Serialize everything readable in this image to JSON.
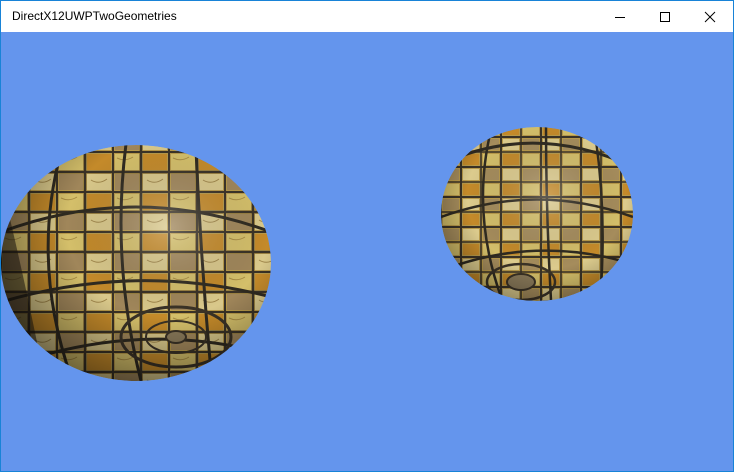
{
  "window": {
    "title": "DirectX12UWPTwoGeometries",
    "clear_color": "#6495ED"
  },
  "caption_buttons": {
    "minimize": "minimize-icon",
    "maximize": "maximize-icon",
    "close": "close-icon"
  },
  "scene": {
    "objects": [
      {
        "name": "textured-sphere-left",
        "texture": "tiled-stone-tiles-gold"
      },
      {
        "name": "textured-sphere-right",
        "texture": "tiled-stone-tiles-gold"
      }
    ]
  }
}
